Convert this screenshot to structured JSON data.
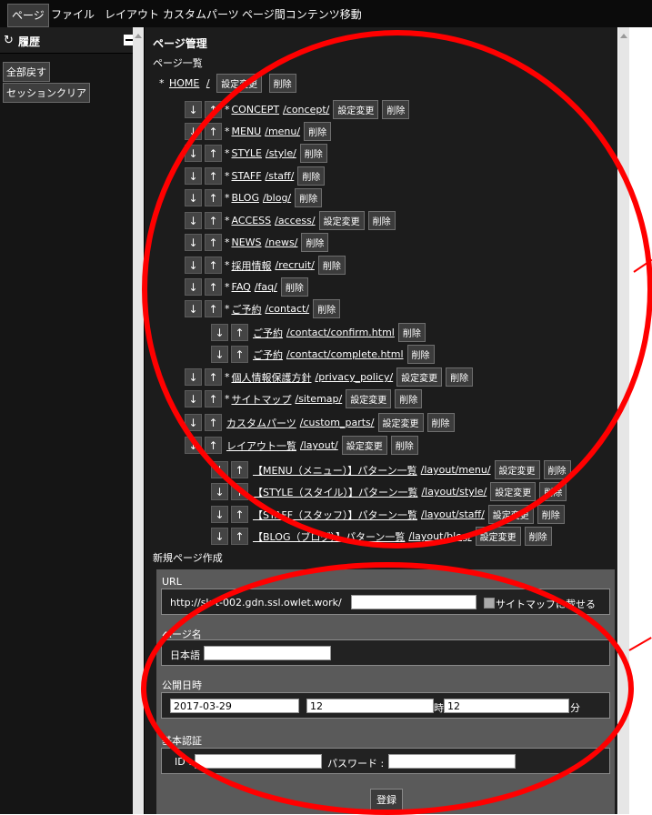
{
  "menu": {
    "items": [
      "ページ",
      "ファイル",
      "レイアウト",
      "カスタムパーツ",
      "ページ間コンテンツ移動"
    ]
  },
  "history": {
    "title": "履歴",
    "undo_all": "全部戻す",
    "clear_session": "セッションクリア"
  },
  "pages": {
    "title": "ページ管理",
    "list_heading": "ページ一覧",
    "arrows": {
      "down": "↓",
      "up": "↑"
    },
    "btn_settings": "設定変更",
    "btn_delete": "削除",
    "home": {
      "prefix": "*",
      "name": "HOME",
      "path": "/"
    },
    "items": [
      {
        "prefix": "*",
        "name": "CONCEPT",
        "path": "/concept/",
        "settings": true
      },
      {
        "prefix": "*",
        "name": "MENU",
        "path": "/menu/",
        "settings": false
      },
      {
        "prefix": "*",
        "name": "STYLE",
        "path": "/style/",
        "settings": false
      },
      {
        "prefix": "*",
        "name": "STAFF",
        "path": "/staff/",
        "settings": false
      },
      {
        "prefix": "*",
        "name": "BLOG",
        "path": "/blog/",
        "settings": false
      },
      {
        "prefix": "*",
        "name": "ACCESS",
        "path": "/access/",
        "settings": true
      },
      {
        "prefix": "*",
        "name": "NEWS",
        "path": "/news/",
        "settings": false
      },
      {
        "prefix": "*",
        "name": "採用情報",
        "path": "/recruit/",
        "settings": false
      },
      {
        "prefix": "*",
        "name": "FAQ",
        "path": "/faq/",
        "settings": false
      },
      {
        "prefix": "*",
        "name": "ご予約",
        "path": "/contact/",
        "settings": false
      },
      {
        "prefix": "",
        "name": "ご予約",
        "path": "/contact/confirm.html",
        "settings": false,
        "child": true
      },
      {
        "prefix": "",
        "name": "ご予約",
        "path": "/contact/complete.html",
        "settings": false,
        "child": true
      },
      {
        "prefix": "*",
        "name": "個人情報保護方針",
        "path": "/privacy_policy/",
        "settings": true
      },
      {
        "prefix": "*",
        "name": "サイトマップ",
        "path": "/sitemap/",
        "settings": true
      },
      {
        "prefix": "",
        "name": "カスタムパーツ",
        "path": "/custom_parts/",
        "settings": true
      },
      {
        "prefix": "",
        "name": "レイアウト一覧",
        "path": "/layout/",
        "settings": true
      },
      {
        "prefix": "",
        "name": "【MENU（メニュー）】パターン一覧",
        "path": "/layout/menu/",
        "settings": true,
        "child": true
      },
      {
        "prefix": "",
        "name": "【STYLE（スタイル）】パターン一覧",
        "path": "/layout/style/",
        "settings": true,
        "child": true
      },
      {
        "prefix": "",
        "name": "【STAFF（スタッフ）】パターン一覧",
        "path": "/layout/staff/",
        "settings": true,
        "child": true
      },
      {
        "prefix": "",
        "name": "【BLOG（ブログ）】パターン一覧",
        "path": "/layout/blog/",
        "settings": true,
        "child": true
      }
    ]
  },
  "new_page": {
    "heading": "新規ページ作成",
    "url_label": "URL",
    "url_base": "http://sk-t-002.gdn.ssl.owlet.work/",
    "url_value": "",
    "sitemap_label": "サイトマップに載せる",
    "name_label": "ページ名",
    "lang_label": "日本語",
    "name_value": "",
    "date_label": "公開日時",
    "date_value": "2017-03-29",
    "hour_value": "12",
    "hour_unit": "時",
    "minute_value": "12",
    "minute_unit": "分",
    "auth_label": "基本認証",
    "id_label": "ID :",
    "id_value": "",
    "password_label": "パスワード :",
    "password_value": "",
    "submit": "登録"
  }
}
